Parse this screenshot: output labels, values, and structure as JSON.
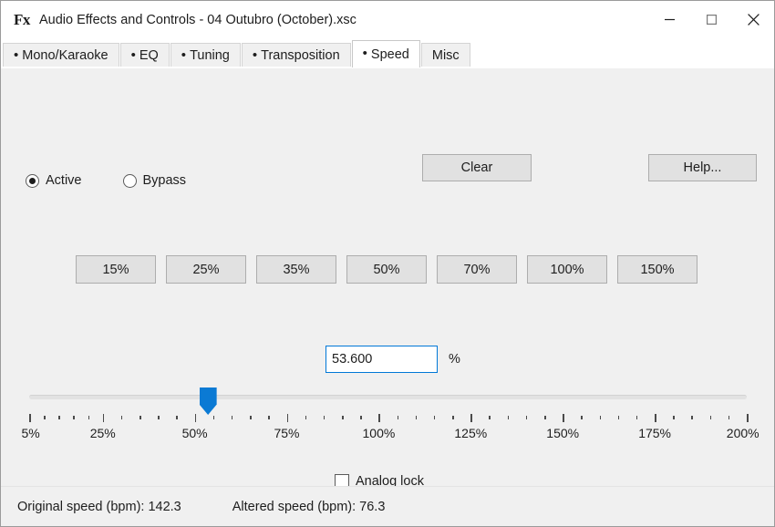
{
  "window": {
    "icon_label": "Fx",
    "icon_name": "fx-app-icon",
    "title": "Audio Effects and Controls - 04 Outubro (October).xsc",
    "controls": [
      {
        "name": "minimize-button",
        "glyph": "minimize"
      },
      {
        "name": "maximize-button",
        "glyph": "maximize"
      },
      {
        "name": "close-button",
        "glyph": "close"
      }
    ]
  },
  "tabs": [
    {
      "label": "Mono/Karaoke",
      "bullet": "•",
      "active": false
    },
    {
      "label": "EQ",
      "bullet": "•",
      "active": false
    },
    {
      "label": "Tuning",
      "bullet": "•",
      "active": false
    },
    {
      "label": "Transposition",
      "bullet": "•",
      "active": false
    },
    {
      "label": "Speed",
      "bullet": "•",
      "active": true
    },
    {
      "label": "Misc",
      "bullet": "",
      "active": false
    }
  ],
  "toolbar": {
    "clear_label": "Clear",
    "help_label": "Help..."
  },
  "mode": {
    "options": [
      {
        "label": "Active",
        "selected": true
      },
      {
        "label": "Bypass",
        "selected": false
      }
    ]
  },
  "presets": [
    {
      "label": "15%"
    },
    {
      "label": "25%"
    },
    {
      "label": "35%"
    },
    {
      "label": "50%"
    },
    {
      "label": "70%"
    },
    {
      "label": "100%"
    },
    {
      "label": "150%"
    }
  ],
  "speed_value": {
    "value": "53.600",
    "placeholder": "",
    "unit": "%"
  },
  "slider": {
    "min_percent": 5,
    "max_percent": 200,
    "current_percent": 53.6,
    "tick_labels": [
      "5%",
      "25%",
      "50%",
      "75%",
      "100%",
      "125%",
      "150%",
      "175%",
      "200%"
    ],
    "tick_values": [
      5,
      25,
      50,
      75,
      100,
      125,
      150,
      175,
      200
    ],
    "minor_ticks_between": 4,
    "thumb_color": "#0b7ad4",
    "track_color": "#e2e2e2"
  },
  "analog_lock": {
    "label": "Analog lock",
    "checked": false
  },
  "status": {
    "original_label": "Original speed (bpm):",
    "original_value": "142.3",
    "altered_label": "Altered speed (bpm):",
    "altered_value": "76.3",
    "original_text": "Original speed (bpm):  142.3",
    "altered_text": "Altered speed (bpm):  76.3"
  },
  "colors": {
    "background": "#f0f0f0",
    "accent": "#0078d7",
    "slider_thumb": "#0b7ad4",
    "button_face": "#e1e1e1",
    "button_border": "#adadad",
    "text": "#1d1d1d"
  }
}
